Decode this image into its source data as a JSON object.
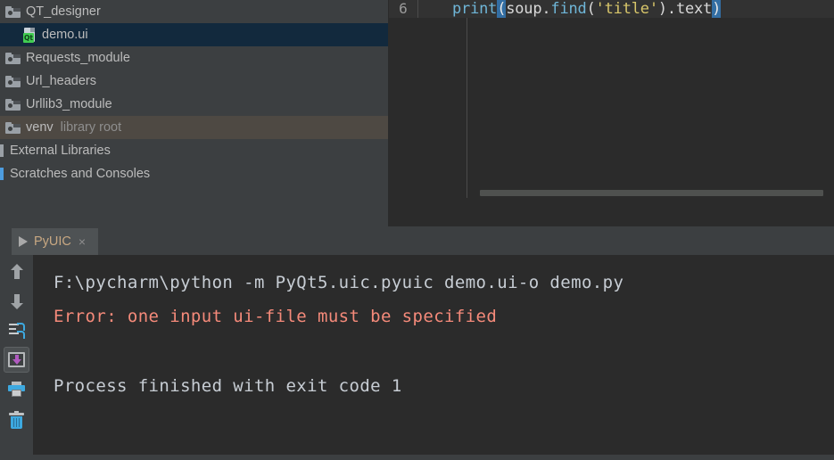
{
  "project_tree": {
    "name": "project-tool-window",
    "rows": [
      {
        "label": "QT_designer",
        "sub": "",
        "icon": "folder-icon",
        "indent": 0,
        "state": "normal"
      },
      {
        "label": "demo.ui",
        "sub": "",
        "icon": "qt-ui-file-icon",
        "indent": 1,
        "state": "selected"
      },
      {
        "label": "Requests_module",
        "sub": "",
        "icon": "folder-icon",
        "indent": 0,
        "state": "normal"
      },
      {
        "label": "Url_headers",
        "sub": "",
        "icon": "folder-icon",
        "indent": 0,
        "state": "normal"
      },
      {
        "label": "Urllib3_module",
        "sub": "",
        "icon": "folder-icon",
        "indent": 0,
        "state": "normal"
      },
      {
        "label": "venv",
        "sub": "library root",
        "icon": "folder-icon",
        "indent": 0,
        "state": "hovered"
      },
      {
        "label": "External Libraries",
        "sub": "",
        "icon": "library-icon",
        "indent": 0,
        "state": "normal"
      },
      {
        "label": "Scratches and Consoles",
        "sub": "",
        "icon": "scratch-icon",
        "indent": 0,
        "state": "normal"
      }
    ]
  },
  "editor": {
    "line_number": "6",
    "code_tokens": [
      {
        "text": "print",
        "type": "function"
      },
      {
        "text": "(",
        "type": "brace-match"
      },
      {
        "text": "soup.",
        "type": "plain"
      },
      {
        "text": "find",
        "type": "function"
      },
      {
        "text": "(",
        "type": "plain"
      },
      {
        "text": "'title'",
        "type": "string"
      },
      {
        "text": ")",
        "type": "plain"
      },
      {
        "text": ".text",
        "type": "plain"
      },
      {
        "text": ")",
        "type": "brace-match"
      }
    ],
    "full_line": "print(soup.find('title').text)"
  },
  "console": {
    "tab_label": "PyUIC",
    "close_label": "×",
    "toolbar": [
      {
        "name": "scroll-up-button",
        "icon": "arrow-up-icon",
        "active": false
      },
      {
        "name": "scroll-down-button",
        "icon": "arrow-down-icon",
        "active": false
      },
      {
        "name": "soft-wrap-button",
        "icon": "soft-wrap-icon",
        "active": false
      },
      {
        "name": "scroll-to-end-button",
        "icon": "print-to-file-icon",
        "active": true
      },
      {
        "name": "print-button",
        "icon": "printer-icon",
        "active": false
      },
      {
        "name": "clear-all-button",
        "icon": "trash-icon",
        "active": false
      }
    ],
    "output": [
      {
        "text": "F:\\pycharm\\python -m PyQt5.uic.pyuic demo.ui-o demo.py",
        "kind": "command"
      },
      {
        "text": "Error: one input ui-file must be specified",
        "kind": "error"
      },
      {
        "text": "Process finished with exit code 1",
        "kind": "result"
      }
    ]
  },
  "colors": {
    "panel_bg": "#3c3f41",
    "editor_bg": "#2b2b2b",
    "selection_blue": "#12293d",
    "hover_brown": "#4e4943",
    "error_red": "#f58a7a",
    "keyword_blue": "#6fb6d8",
    "string_yellow": "#d8c66a",
    "brace_match": "#336ea3",
    "tab_title": "#c8a882",
    "accent_blue": "#3da9e0"
  }
}
